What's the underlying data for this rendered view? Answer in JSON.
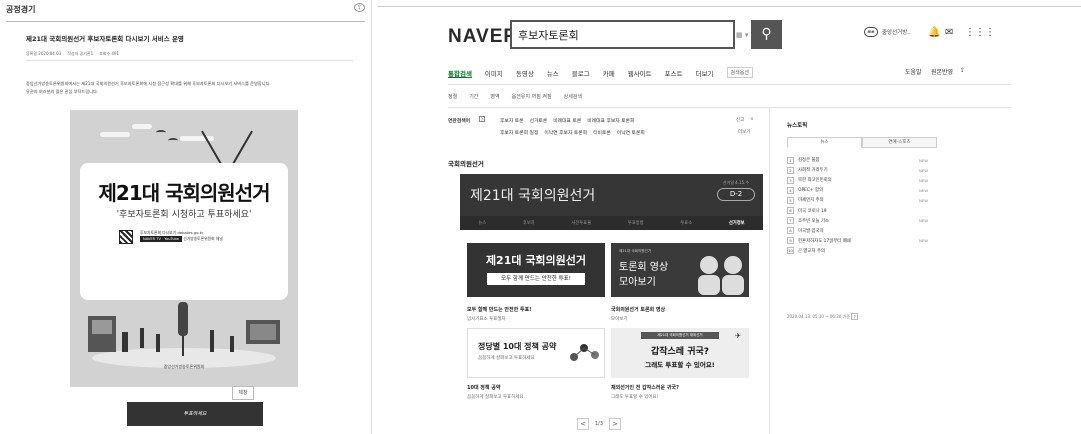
{
  "left": {
    "header_title": "공정경기",
    "post_title": "제21대 국회의원선거 후보자토론회 다시보기 서비스 운영",
    "meta": [
      "등록일 2020.04.03",
      "작성자 공기관1",
      "조회수 491"
    ],
    "body": [
      "중앙선거방송토론위원회에서는 제21대 국회의원선거 후보자토론회에 시청 접근성 확대를 위해 후보자토론회 다시보기 서비스를 운영합니다.",
      "유권자 여러분의 많은 관심 부탁드립니다."
    ],
    "poster": {
      "title": "제21대 국회의원선거",
      "subtitle": "'후보자토론회 시청하고 투표하세요'",
      "info_line1": "후보자토론회 다시보기 debates.go.kr",
      "tv_label": "NAVER TV · YouTube",
      "info_line2": "선거방송토론위원회 채널",
      "footer": "중앙선거방송토론위원회"
    },
    "stamp": "제창",
    "dark_bar": "투표하세요"
  },
  "naver": {
    "logo": "NAVER",
    "search_value": "후보자토론회",
    "keyboard_icon": "keyboard-icon",
    "user_label": "중앙선거방..",
    "tabs": [
      "통합검색",
      "이미지",
      "동영상",
      "뉴스",
      "블로그",
      "카페",
      "웹사이트",
      "포스트",
      "더보기",
      "검색옵션"
    ],
    "tab_right": [
      "도움말",
      "원본반영"
    ],
    "filters": [
      "정렬",
      "기간",
      "영역",
      "옵션유지",
      "상세검색"
    ],
    "filter_extra": "꺼짐 켜짐",
    "related": {
      "label": "연관검색어",
      "help": "?",
      "row1": [
        "후보자 토론",
        "선거토론",
        "비례대표 토론",
        "비례대표 후보자 토론회"
      ],
      "row2": [
        "후보자 토론회 일정",
        "이낙연 후보자 토론회",
        "티비토론",
        "이낙연 토론회"
      ],
      "btn_report": "신고",
      "btn_close": "×",
      "btn_more": "더보기"
    },
    "section_title": "국회의원선거",
    "election": {
      "title": "제21대 국회의원선거",
      "date": "선거일 4.15.수",
      "dday": "D-2",
      "subtabs": [
        "뉴스",
        "후보자",
        "사전투표율",
        "투표방법",
        "투표소",
        "선거정보"
      ]
    },
    "cards": [
      {
        "thumb_big": "제21대 국회의원선거",
        "thumb_small": "모두 함께 만드는 안전한 투표!",
        "title": "모두 함께 만드는 안전한 투표!",
        "sub": "임시기표소 투표절차"
      },
      {
        "thumb_small": "제21대 국회의원선거",
        "thumb_big": "토론회 영상",
        "thumb_big2": "모아보기",
        "title": "국회의원선거 토론회 영상",
        "sub": "모아보기"
      },
      {
        "thumb_big": "정당별 10대 정책 공약",
        "thumb_small": "꼼꼼하게 살펴보고 투표하세요",
        "title": "10대 정책 공약",
        "sub": "꼼꼼하게 살펴보고 투표하세요."
      },
      {
        "thumb_small": "제21대 국회의원선거 재외선거",
        "thumb_big": "갑작스레 귀국?",
        "thumb_big2": "그래도 투표할 수 있어요!",
        "title": "재외선거인 전 갑작스러운 귀국?",
        "sub": "그래도 투표할 수 있어요!"
      }
    ],
    "pager": {
      "prev": "<",
      "page": "1/3",
      "next": ">"
    },
    "news_topic": {
      "title": "뉴스토픽",
      "tabs": [
        "뉴스",
        "연예·스포츠"
      ],
      "items": [
        {
          "n": "1",
          "t": "김정은 불참",
          "new": "NEW"
        },
        {
          "n": "2",
          "t": "사회적 거리두기",
          "new": "NEW"
        },
        {
          "n": "3",
          "t": "북한 최고인민회의",
          "new": "NEW"
        },
        {
          "n": "4",
          "t": "OPEC+ 합의",
          "new": "NEW"
        },
        {
          "n": "5",
          "t": "미세먼지 주의",
          "new": "NEW"
        },
        {
          "n": "6",
          "t": "미국 코로나 19",
          "new": ""
        },
        {
          "n": "7",
          "t": "조주빈 오늘 기소",
          "new": "NEW"
        },
        {
          "n": "8",
          "t": "미국발 입국자",
          "new": ""
        },
        {
          "n": "9",
          "t": "헌혼저하자도 17일부터 폐쇄",
          "new": "NEW"
        },
        {
          "n": "10",
          "t": "곤 열교차 주의",
          "new": ""
        }
      ],
      "timestamp": "2020.04.13. 05:30 ~ 06:30 기준"
    }
  }
}
